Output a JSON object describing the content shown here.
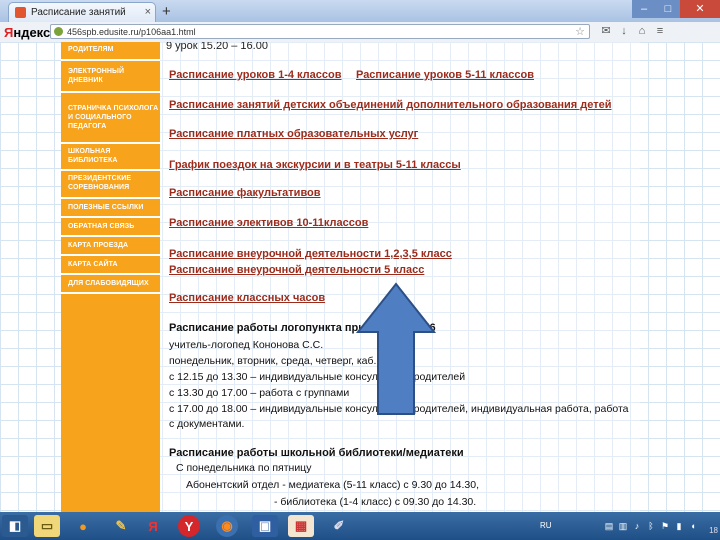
{
  "browser": {
    "tab_title": "Расписание занятий",
    "new_tab": "+",
    "tab_close": "×",
    "logo_letter": "Я",
    "logo_rest": "ндекс",
    "url": "456spb.edusite.ru/p106aa1.html",
    "star": "☆",
    "window_controls": {
      "minimize": "–",
      "maximize": "□",
      "close": "✕"
    }
  },
  "sidebar": {
    "items": [
      {
        "label": "РОДИТЕЛЯМ"
      },
      {
        "label": "ЭЛЕКТРОННЫЙ ДНЕВНИК"
      },
      {
        "label": "СТРАНИЧКА ПСИХОЛОГА И СОЦИАЛЬНОГО ПЕДАГОГА"
      },
      {
        "label": "ШКОЛЬНАЯ БИБЛИОТЕКА"
      },
      {
        "label": "ПРЕЗИДЕНТСКИЕ СОРЕВНОВАНИЯ"
      },
      {
        "label": "ПОЛЕЗНЫЕ ССЫЛКИ"
      },
      {
        "label": "ОБРАТНАЯ СВЯЗЬ"
      },
      {
        "label": "КАРТА ПРОЕЗДА"
      },
      {
        "label": "КАРТА САЙТА"
      },
      {
        "label": "ДЛЯ СЛАБОВИДЯЩИХ"
      }
    ]
  },
  "content": {
    "lesson_line": "9 урок   15.20 – 16.00",
    "links": {
      "lessons_1_4": "Расписание уроков 1-4 классов",
      "lessons_5_11": "Расписание уроков 5-11 классов",
      "clubs": "Расписание занятий детских объединений дополнительного образования детей",
      "paid": "Расписание платных образовательных услуг",
      "trips": "График поездок на экскурсии и в театры 5-11 классы",
      "electives": "Расписание факультативов",
      "electives_10_11": "Расписание элективов 10-11классов",
      "extracurricular_1235": "Расписание внеурочной деятельности 1,2,3,5 класс",
      "extracurricular_5": "Расписание внеурочной деятельности 5 класс",
      "class_hours": "Расписание классных часов"
    },
    "speech_therapy": {
      "title": "Расписание работы логопункта при школе №456",
      "lines": [
        "учитель-логопед Кононова С.С.",
        "понедельник, вторник, среда, четверг, каб.",
        "с 12.15 до 13.30 – индивидуальные консультации родителей",
        "с 13.30 до 17.00 – работа с группами",
        "с 17.00 до 18.00 – индивидуальные консультации родителей, индивидуальная работа, работа",
        "с документами."
      ]
    },
    "library": {
      "title": "Расписание работы школьной библиотеки/медиатеки",
      "lines": [
        "С понедельника по пятницу",
        "Абонентский отдел - медиатека (5-11 класс) с 9.30 до 14.30,",
        "- библиотека (1-4 класс) с 09.30 до 14.30."
      ]
    }
  },
  "taskbar": {
    "lang": "RU",
    "clock": "18"
  },
  "colors": {
    "sidebar": "#f7a31b",
    "link": "#9b2c1c",
    "arrow_fill": "#4f7ec2",
    "arrow_stroke": "#2c4f86"
  }
}
